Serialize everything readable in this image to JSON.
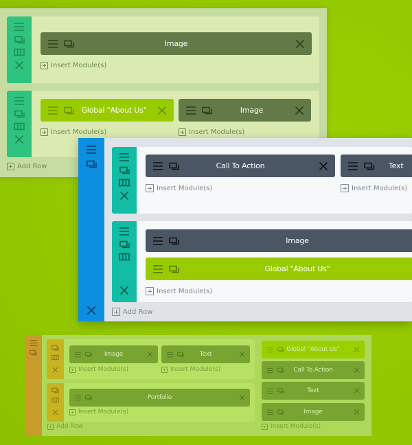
{
  "colors": {
    "background": "#93c900",
    "active_section_bar": "#0c8fe0",
    "active_row_bar": "#12bca5",
    "dark_module": "#4b5664",
    "global_module": "#99cc00",
    "faded_row_bar": "#2ec37e",
    "faded_module": "#617a47",
    "bottom_section_bar": "#c79c2a",
    "bottom_row_bar": "#c7b420"
  },
  "icons": {
    "move": "hamburger-lines",
    "duplicate": "stacked-squares",
    "columns": "three-column-grid",
    "delete": "x-cross",
    "insert": "plus-in-box"
  },
  "sections": [
    {
      "id": "top-section",
      "add_row_label": "Add Row",
      "rows": [
        {
          "columns": [
            {
              "modules": [
                {
                  "label": "Image",
                  "type": "standard"
                }
              ],
              "insert_label": "Insert Module(s)"
            }
          ]
        },
        {
          "columns": [
            {
              "modules": [
                {
                  "label": "Global \"About Us\"",
                  "type": "global"
                }
              ],
              "insert_label": "Insert Module(s)"
            },
            {
              "modules": [
                {
                  "label": "Image",
                  "type": "standard"
                }
              ],
              "insert_label": "Insert Module(s)"
            }
          ]
        }
      ]
    },
    {
      "id": "active-section",
      "add_row_label": "Add Row",
      "rows": [
        {
          "columns": [
            {
              "modules": [
                {
                  "label": "Call To Action",
                  "type": "standard"
                }
              ],
              "insert_label": "Insert Module(s)"
            },
            {
              "modules": [
                {
                  "label": "Text",
                  "type": "standard"
                }
              ],
              "insert_label": "Insert Module(s)"
            }
          ]
        },
        {
          "columns": [
            {
              "modules": [
                {
                  "label": "Image",
                  "type": "standard"
                },
                {
                  "label": "Global \"About Us\"",
                  "type": "global"
                }
              ],
              "insert_label": "Insert Module(s)"
            }
          ]
        }
      ]
    },
    {
      "id": "bottom-section",
      "add_row_label": "Add Row",
      "rows": [
        {
          "columns": [
            {
              "modules": [
                {
                  "label": "Image",
                  "type": "standard"
                }
              ],
              "insert_label": "Insert Module(s)"
            },
            {
              "modules": [
                {
                  "label": "Text",
                  "type": "standard"
                }
              ],
              "insert_label": "Insert Module(s)"
            }
          ]
        },
        {
          "columns": [
            {
              "modules": [
                {
                  "label": "Portfolio",
                  "type": "standard"
                }
              ],
              "insert_label": "Insert Module(s)"
            }
          ]
        }
      ],
      "side_column": {
        "modules": [
          {
            "label": "Global \"About Us\"",
            "type": "global"
          },
          {
            "label": "Call To Action",
            "type": "standard"
          },
          {
            "label": "Text",
            "type": "standard"
          },
          {
            "label": "Image",
            "type": "standard"
          }
        ],
        "insert_label": "Insert Module(s)"
      }
    }
  ]
}
